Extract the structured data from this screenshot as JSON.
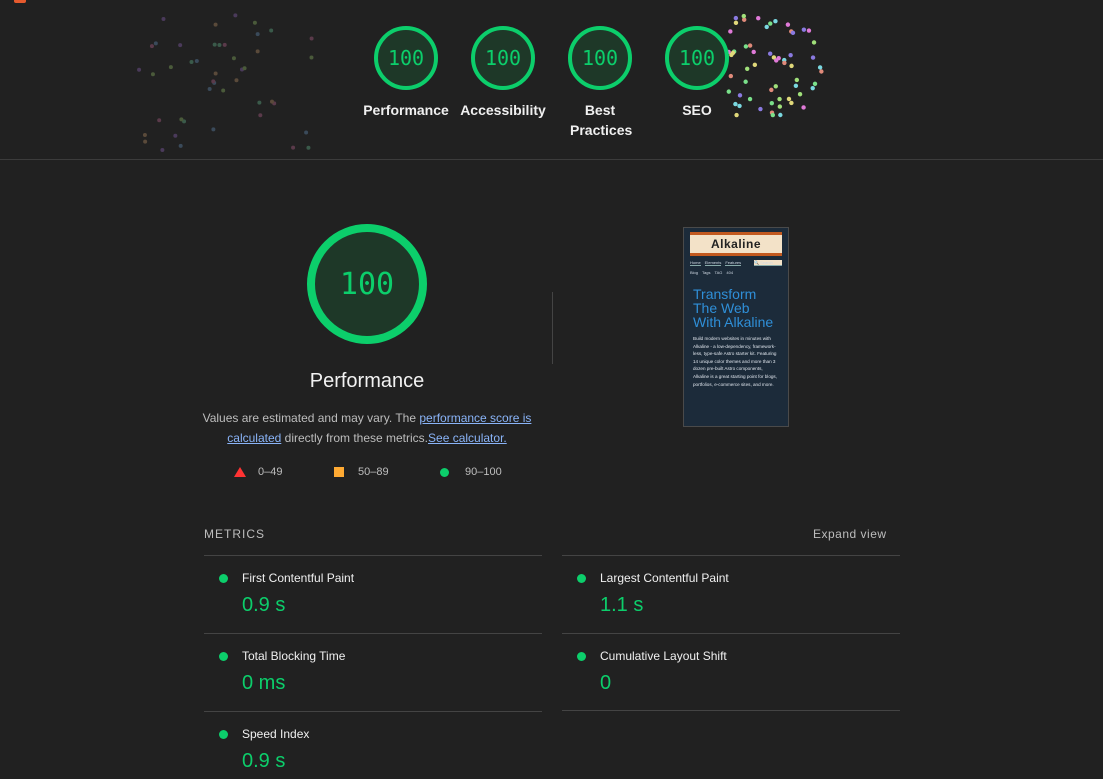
{
  "header": {
    "gauges": [
      {
        "score": "100",
        "label": "Performance"
      },
      {
        "score": "100",
        "label": "Accessibility"
      },
      {
        "score": "100",
        "label": "Best Practices"
      },
      {
        "score": "100",
        "label": "SEO"
      }
    ]
  },
  "performance": {
    "score": "100",
    "title": "Performance",
    "desc_prefix": "Values are estimated and may vary. The ",
    "desc_link1": "performance score is calculated",
    "desc_middle": " directly from these metrics.",
    "desc_link2": "See calculator.",
    "legend": {
      "fail": "0–49",
      "average": "50–89",
      "pass": "90–100"
    },
    "colors": {
      "pass": "#0cce6b",
      "average": "#ffaa33",
      "fail": "#ff3333"
    }
  },
  "screenshot": {
    "site_name": "Alkaline",
    "nav": [
      "Home",
      "Elements",
      "Features"
    ],
    "search": "🔍 Search",
    "tags": [
      "Blog",
      "Tags",
      "TAG",
      "404"
    ],
    "heading": "Transform The Web With Alkaline",
    "body": "Build modern websites in minutes with Alkaline - a low-dependency, framework-less, type-safe Astro starter kit. Featuring 14 unique color themes and more than 3 dozen pre-built Astro components, Alkaline is a great starting point for blogs, portfolios, e-commerce sites, and more."
  },
  "metrics": {
    "label": "METRICS",
    "expand": "Expand view",
    "items": [
      {
        "name": "First Contentful Paint",
        "value": "0.9 s"
      },
      {
        "name": "Largest Contentful Paint",
        "value": "1.1 s"
      },
      {
        "name": "Total Blocking Time",
        "value": "0 ms"
      },
      {
        "name": "Cumulative Layout Shift",
        "value": "0"
      },
      {
        "name": "Speed Index",
        "value": "0.9 s"
      }
    ]
  }
}
